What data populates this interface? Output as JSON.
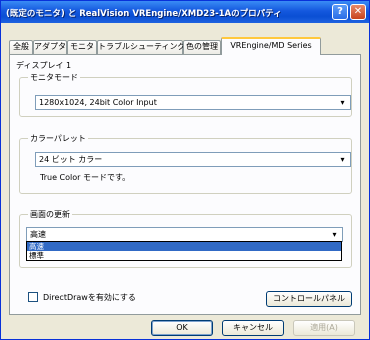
{
  "window": {
    "title": "(既定のモニタ) と RealVision VREngine/XMD23-1Aのプロパティ",
    "help_label": "?",
    "close_label": "✕"
  },
  "tabs": [
    {
      "label": "全般"
    },
    {
      "label": "アダプタ"
    },
    {
      "label": "モニタ"
    },
    {
      "label": "トラブルシューティング"
    },
    {
      "label": "色の管理"
    },
    {
      "label": "VREngine/MD Series"
    }
  ],
  "display_label": "ディスプレイ 1",
  "monitor_mode": {
    "title": "モニタモード",
    "value": "1280x1024, 24bit Color Input"
  },
  "color_palette": {
    "title": "カラーパレット",
    "value": "24 ビット カラー",
    "description": "True Color モードです。"
  },
  "screen_update": {
    "title": "画面の更新",
    "value": "高速",
    "options": [
      "高速",
      "標準"
    ]
  },
  "directdraw_label": "DirectDrawを有効にする",
  "control_panel_button": "コントロールパネル",
  "footer": {
    "ok": "OK",
    "cancel": "キャンセル",
    "apply": "適用(A)"
  },
  "icons": {
    "combo_arrow": "▾"
  }
}
